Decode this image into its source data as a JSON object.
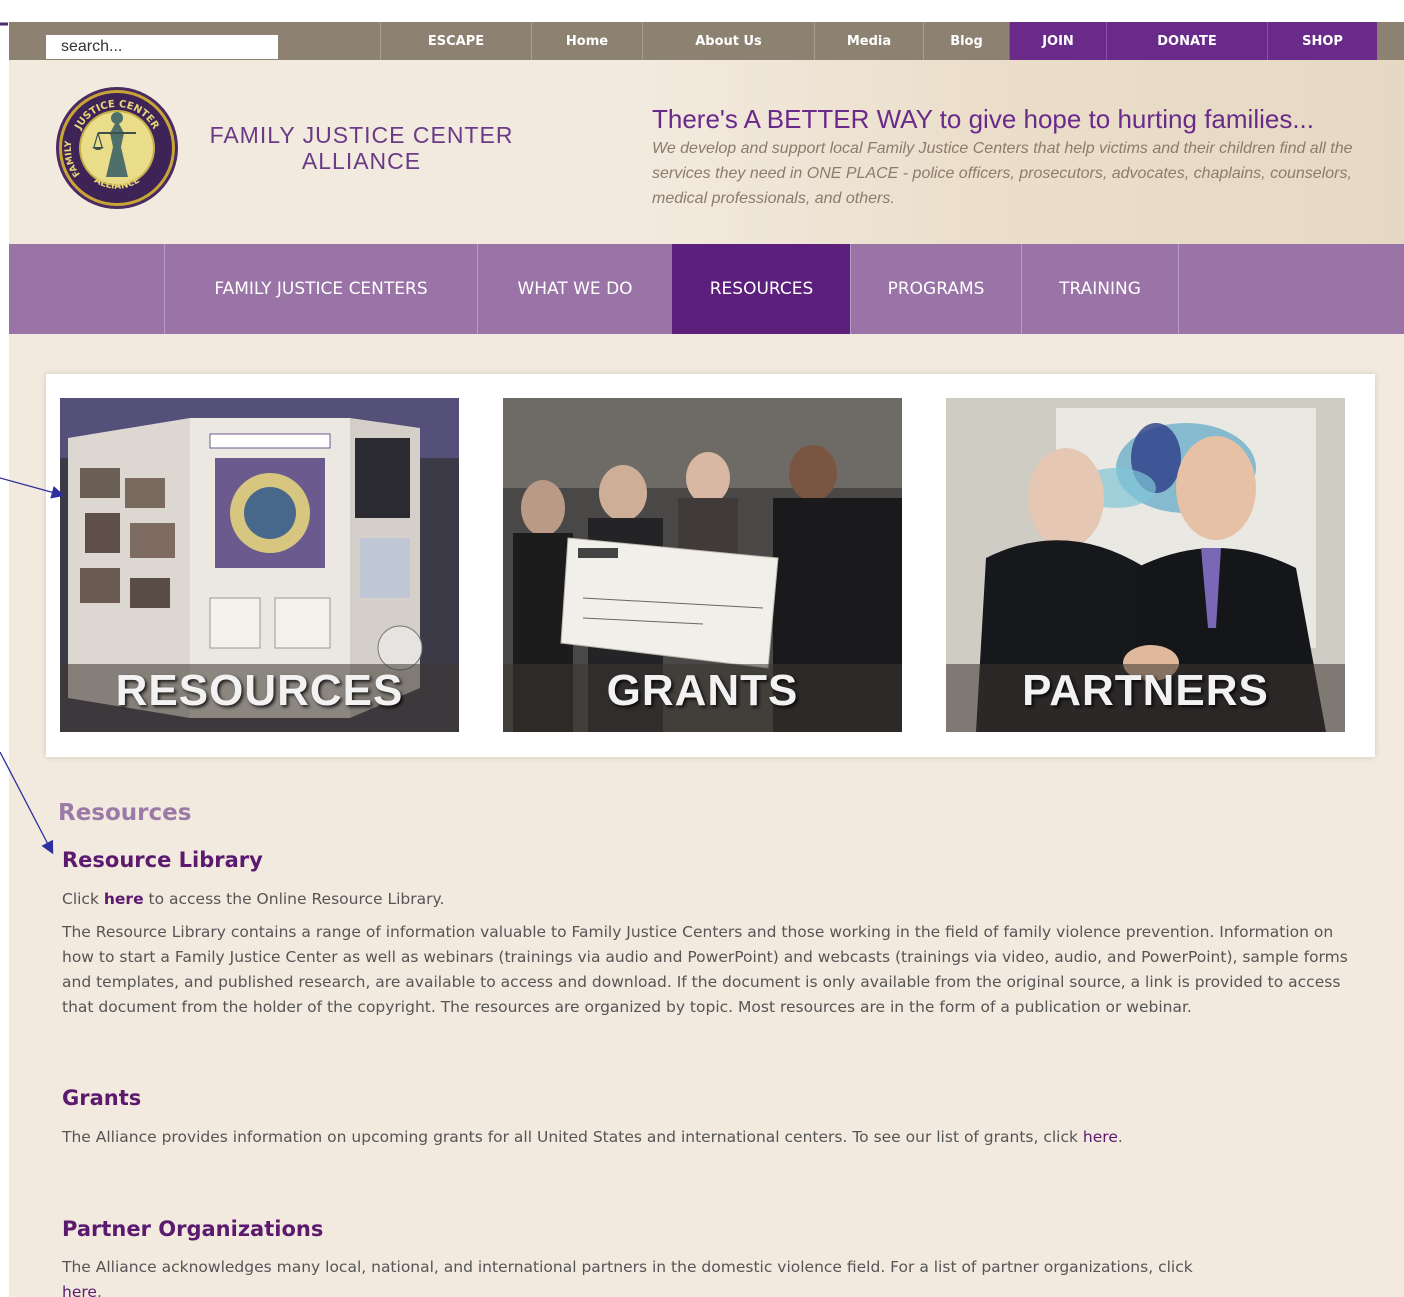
{
  "search": {
    "placeholder": "search..."
  },
  "top_nav": [
    {
      "label": "ESCAPE"
    },
    {
      "label": "Home"
    },
    {
      "label": "About Us"
    },
    {
      "label": "Media"
    },
    {
      "label": "Blog"
    },
    {
      "label": "JOIN"
    },
    {
      "label": "DONATE"
    },
    {
      "label": "SHOP"
    }
  ],
  "header": {
    "org_line1": "FAMILY JUSTICE CENTER",
    "org_line2": "ALLIANCE",
    "logo_top_text": "JUSTICE CENTER",
    "logo_left_text": "FAMILY",
    "logo_bottom_text": "ALLIANCE",
    "tagline_title": "There's A BETTER WAY to give hope to hurting families...",
    "tagline_text": "We develop and support local Family Justice Centers that help victims and their children find all the services they need in ONE PLACE - police officers, prosecutors, advocates, chaplains, counselors, medical professionals, and others."
  },
  "main_nav": [
    {
      "label": "FAMILY JUSTICE CENTERS"
    },
    {
      "label": "WHAT WE DO"
    },
    {
      "label": "RESOURCES",
      "active": true
    },
    {
      "label": "PROGRAMS"
    },
    {
      "label": "TRAINING"
    }
  ],
  "features": [
    {
      "label": "RESOURCES",
      "image_icon": "display-board-photo-icon"
    },
    {
      "label": "GRANTS",
      "image_icon": "check-presentation-photo-icon"
    },
    {
      "label": "PARTNERS",
      "image_icon": "handshake-photo-icon"
    }
  ],
  "content": {
    "section_title": "Resources",
    "library": {
      "heading": "Resource Library",
      "click_prefix": "Click",
      "click_link": "here",
      "click_suffix": "to access the Online Resource Library.",
      "body": "The Resource Library contains a range of information valuable to Family Justice Centers and those working in the field of family violence prevention. Information on how to start a Family Justice Center as well as webinars (trainings via audio and PowerPoint) and webcasts (trainings via video, audio, and PowerPoint), sample forms and templates, and published research, are available to access and download. If the document is only available from the original source, a link is provided to access that document from the holder of the copyright. The resources are organized by topic. Most resources are in the form of a publication or webinar."
    },
    "grants": {
      "heading": "Grants",
      "body": "The Alliance provides information on upcoming grants for all United States and international centers. To see our list of grants, click",
      "link": "here",
      "suffix": "."
    },
    "partners": {
      "heading": "Partner Organizations",
      "body": "The Alliance acknowledges many local, national, and international partners in the domestic violence field. For a list of partner organizations, click",
      "link": "here",
      "suffix": "."
    }
  },
  "colors": {
    "page_bg": "#f3eadf",
    "top_bar": "#8d8271",
    "purple_dark": "#6a2a8a",
    "nav_purple": "#9a73a7",
    "nav_active": "#5c1f7c",
    "heading_purple": "#5c1a6e",
    "annotation_arrow": "#2e2e9e"
  }
}
